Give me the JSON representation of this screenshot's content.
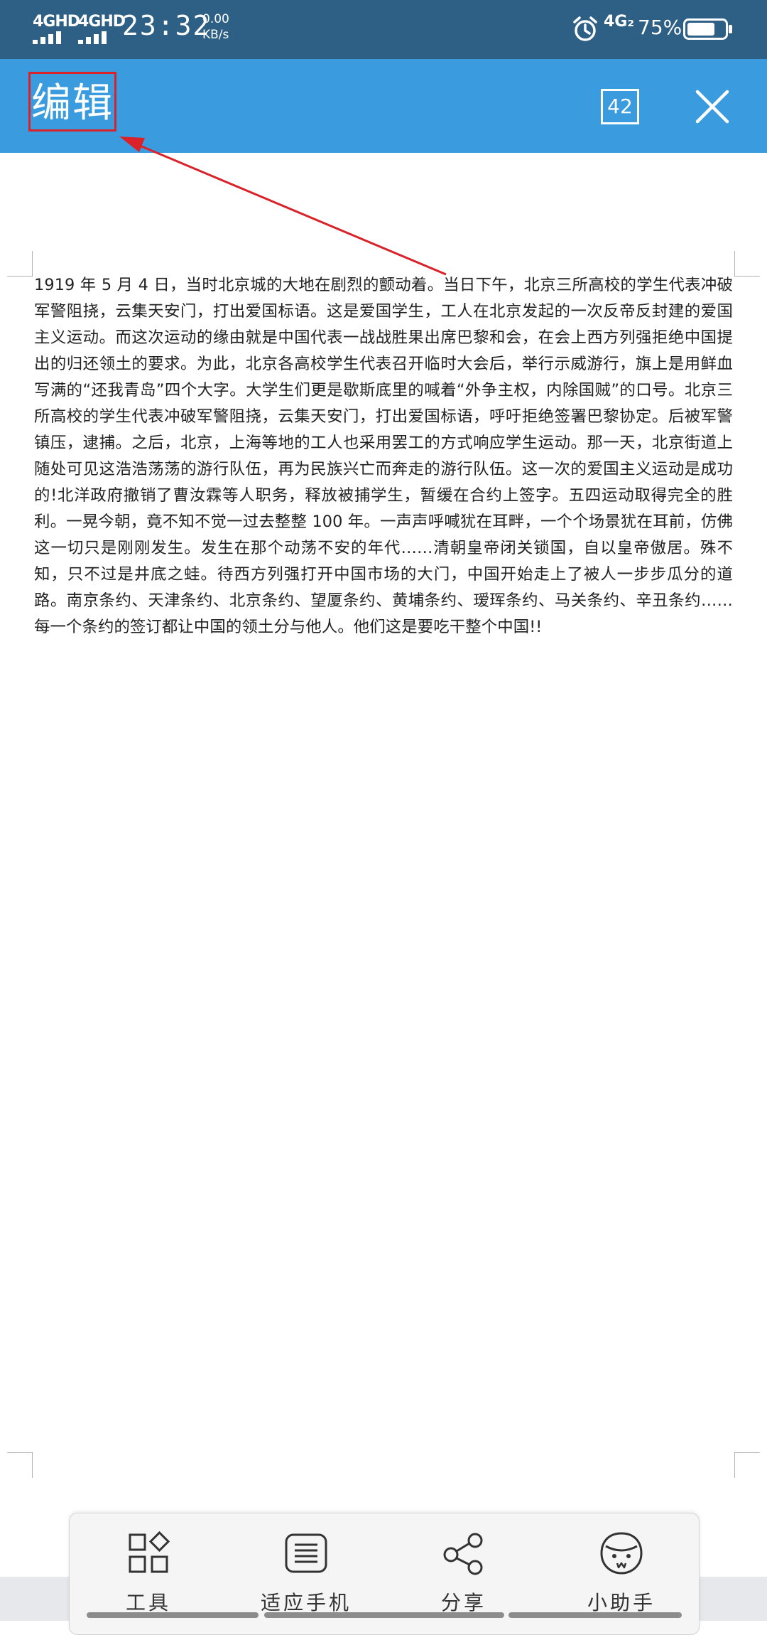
{
  "status_bar": {
    "sim1_label": "4GHD",
    "sim2_label": "4GHD",
    "time": "23:32",
    "net_speed_value": "0.00",
    "net_speed_unit": "KB/s",
    "alarm_icon": "alarm-clock-icon",
    "network_label": "4G₂",
    "battery_percent": "75%",
    "battery_level": 0.75
  },
  "header": {
    "edit_label": "编辑",
    "page_count": "42",
    "close_icon": "close-icon"
  },
  "document": {
    "text": "1919 年 5 月 4 日，当时北京城的大地在剧烈的颤动着。当日下午，北京三所高校的学生代表冲破军警阻挠，云集天安门，打出爱国标语。这是爱国学生，工人在北京发起的一次反帝反封建的爱国主义运动。而这次运动的缘由就是中国代表一战战胜果出席巴黎和会，在会上西方列强拒绝中国提出的归还领土的要求。为此，北京各高校学生代表召开临时大会后，举行示威游行，旗上是用鲜血写满的“还我青岛”四个大字。大学生们更是歇斯底里的喊着“外争主权，内除国贼”的口号。北京三所高校的学生代表冲破军警阻挠，云集天安门，打出爱国标语，呼吁拒绝签署巴黎协定。后被军警镇压，逮捕。之后，北京，上海等地的工人也采用罢工的方式响应学生运动。那一天，北京街道上随处可见这浩浩荡荡的游行队伍，再为民族兴亡而奔走的游行队伍。这一次的爱国主义运动是成功的!北洋政府撤销了曹汝霖等人职务，释放被捕学生，暂缓在合约上签字。五四运动取得完全的胜利。一晃今朝，竟不知不觉一过去整整 100 年。一声声呼喊犹在耳畔，一个个场景犹在耳前，仿佛这一切只是刚刚发生。发生在那个动荡不安的年代……清朝皇帝闭关锁国，自以皇帝傲居。殊不知，只不过是井底之蛙。待西方列强打开中国市场的大门，中国开始走上了被人一步步瓜分的道路。南京条约、天津条约、北京条约、望厦条约、黄埔条约、瑷珲条约、马关条约、辛丑条约……每一个条约的签订都让中国的领土分与他人。他们这是要吃干整个中国!!"
  },
  "toolbar": {
    "items": [
      {
        "label": "工具",
        "icon": "tools-grid-icon"
      },
      {
        "label": "适应手机",
        "icon": "fit-phone-icon"
      },
      {
        "label": "分享",
        "icon": "share-icon"
      },
      {
        "label": "小助手",
        "icon": "assistant-face-icon"
      }
    ]
  },
  "colors": {
    "status_bar_bg": "#2e5f84",
    "header_bg": "#3a9cde",
    "annotation_red": "#d9222a",
    "toolbar_bg": "#f5f5f5"
  }
}
